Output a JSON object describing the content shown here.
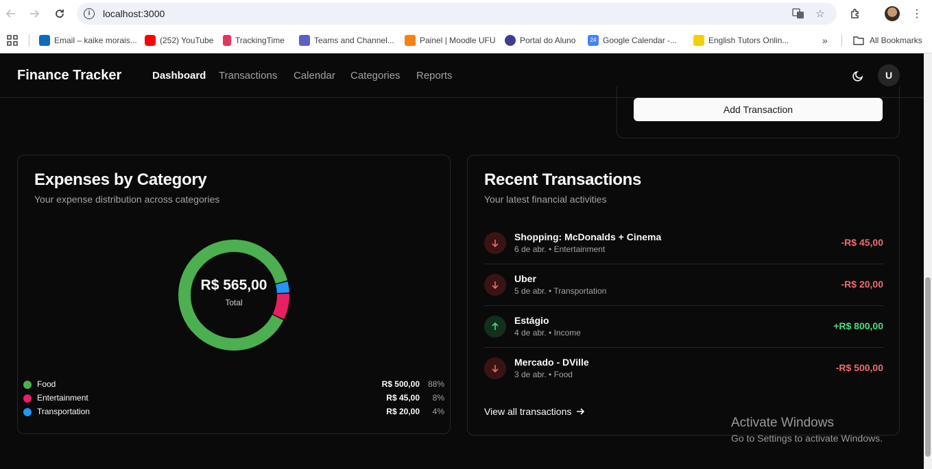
{
  "browser": {
    "url": "localhost:3000",
    "bookmarks": [
      {
        "label": "Email – kaike morais...",
        "icon": "outlook-icon",
        "color": "#0f6cbd"
      },
      {
        "label": "(252) YouTube",
        "icon": "youtube-icon",
        "color": "#ff0000"
      },
      {
        "label": "TrackingTime",
        "icon": "trackingtime-icon",
        "color": "#e8335a"
      },
      {
        "label": "Teams and Channel...",
        "icon": "teams-icon",
        "color": "#5b5fc7"
      },
      {
        "label": "Painel | Moodle UFU",
        "icon": "moodle-icon",
        "color": "#f98012"
      },
      {
        "label": "Portal do Aluno",
        "icon": "portal-icon",
        "color": "#3f3d8f"
      },
      {
        "label": "Google Calendar -...",
        "icon": "calendar-icon",
        "color": "#4285f4",
        "text": "24"
      },
      {
        "label": "English Tutors Onlin...",
        "icon": "tutors-icon",
        "color": "#f5d000"
      }
    ],
    "all_bookmarks": "All Bookmarks"
  },
  "app": {
    "brand": "Finance Tracker",
    "nav": [
      "Dashboard",
      "Transactions",
      "Calendar",
      "Categories",
      "Reports"
    ],
    "active_nav": "Dashboard",
    "avatar": "U",
    "add_transaction": "Add Transaction"
  },
  "expenses": {
    "title": "Expenses by Category",
    "subtitle": "Your expense distribution across categories",
    "total": "R$ 565,00",
    "total_label": "Total",
    "categories": [
      {
        "name": "Food",
        "amount": "R$ 500,00",
        "pct": "88%",
        "value": 500,
        "color": "#4caf50"
      },
      {
        "name": "Entertainment",
        "amount": "R$ 45,00",
        "pct": "8%",
        "value": 45,
        "color": "#e91e63"
      },
      {
        "name": "Transportation",
        "amount": "R$ 20,00",
        "pct": "4%",
        "value": 20,
        "color": "#2196f3"
      }
    ]
  },
  "recent": {
    "title": "Recent Transactions",
    "subtitle": "Your latest financial activities",
    "transactions": [
      {
        "name": "Shopping: McDonalds + Cinema",
        "meta": "6 de abr. • Entertainment",
        "amount": "-R$ 45,00",
        "type": "out"
      },
      {
        "name": "Uber",
        "meta": "5 de abr. • Transportation",
        "amount": "-R$ 20,00",
        "type": "out"
      },
      {
        "name": "Estágio",
        "meta": "4 de abr. • Income",
        "amount": "+R$ 800,00",
        "type": "in"
      },
      {
        "name": "Mercado - DVille",
        "meta": "3 de abr. • Food",
        "amount": "-R$ 500,00",
        "type": "out"
      }
    ],
    "view_all": "View all transactions"
  },
  "watermark": {
    "line1": "Activate Windows",
    "line2": "Go to Settings to activate Windows."
  }
}
